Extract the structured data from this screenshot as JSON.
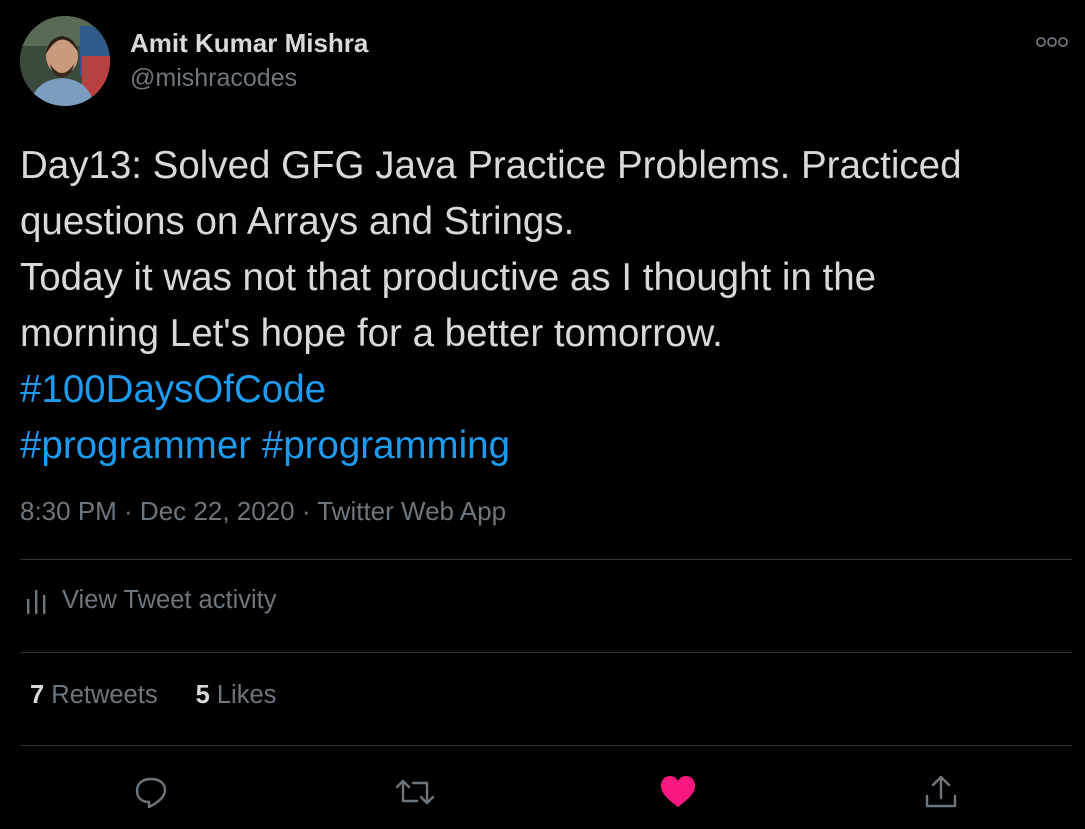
{
  "author": {
    "display_name": "Amit Kumar Mishra",
    "handle": "@mishracodes"
  },
  "tweet": {
    "lines": [
      "Day13: Solved GFG Java Practice Problems. Practiced",
      "questions on Arrays and Strings.",
      "Today it was not that productive as I thought in the",
      "morning Let's hope for a better tomorrow."
    ],
    "hashtags": [
      "#100DaysOfCode",
      "#programmer",
      "#programming"
    ]
  },
  "meta": {
    "text": "8:30 PM · Dec 22, 2020 · Twitter Web App"
  },
  "activity": {
    "label": "View Tweet activity"
  },
  "stats": {
    "retweets_count": "7",
    "retweets_label": "Retweets",
    "likes_count": "5",
    "likes_label": "Likes"
  },
  "icons": {
    "more": "more-icon",
    "activity": "analytics-icon",
    "reply": "reply-icon",
    "retweet": "retweet-icon",
    "like": "heart-icon",
    "share": "share-icon"
  },
  "colors": {
    "background": "#000000",
    "text": "#d9d9d9",
    "secondary": "#6e767d",
    "hashtag": "#1d9bf0",
    "like": "#f91880",
    "divider": "#2f3336"
  }
}
